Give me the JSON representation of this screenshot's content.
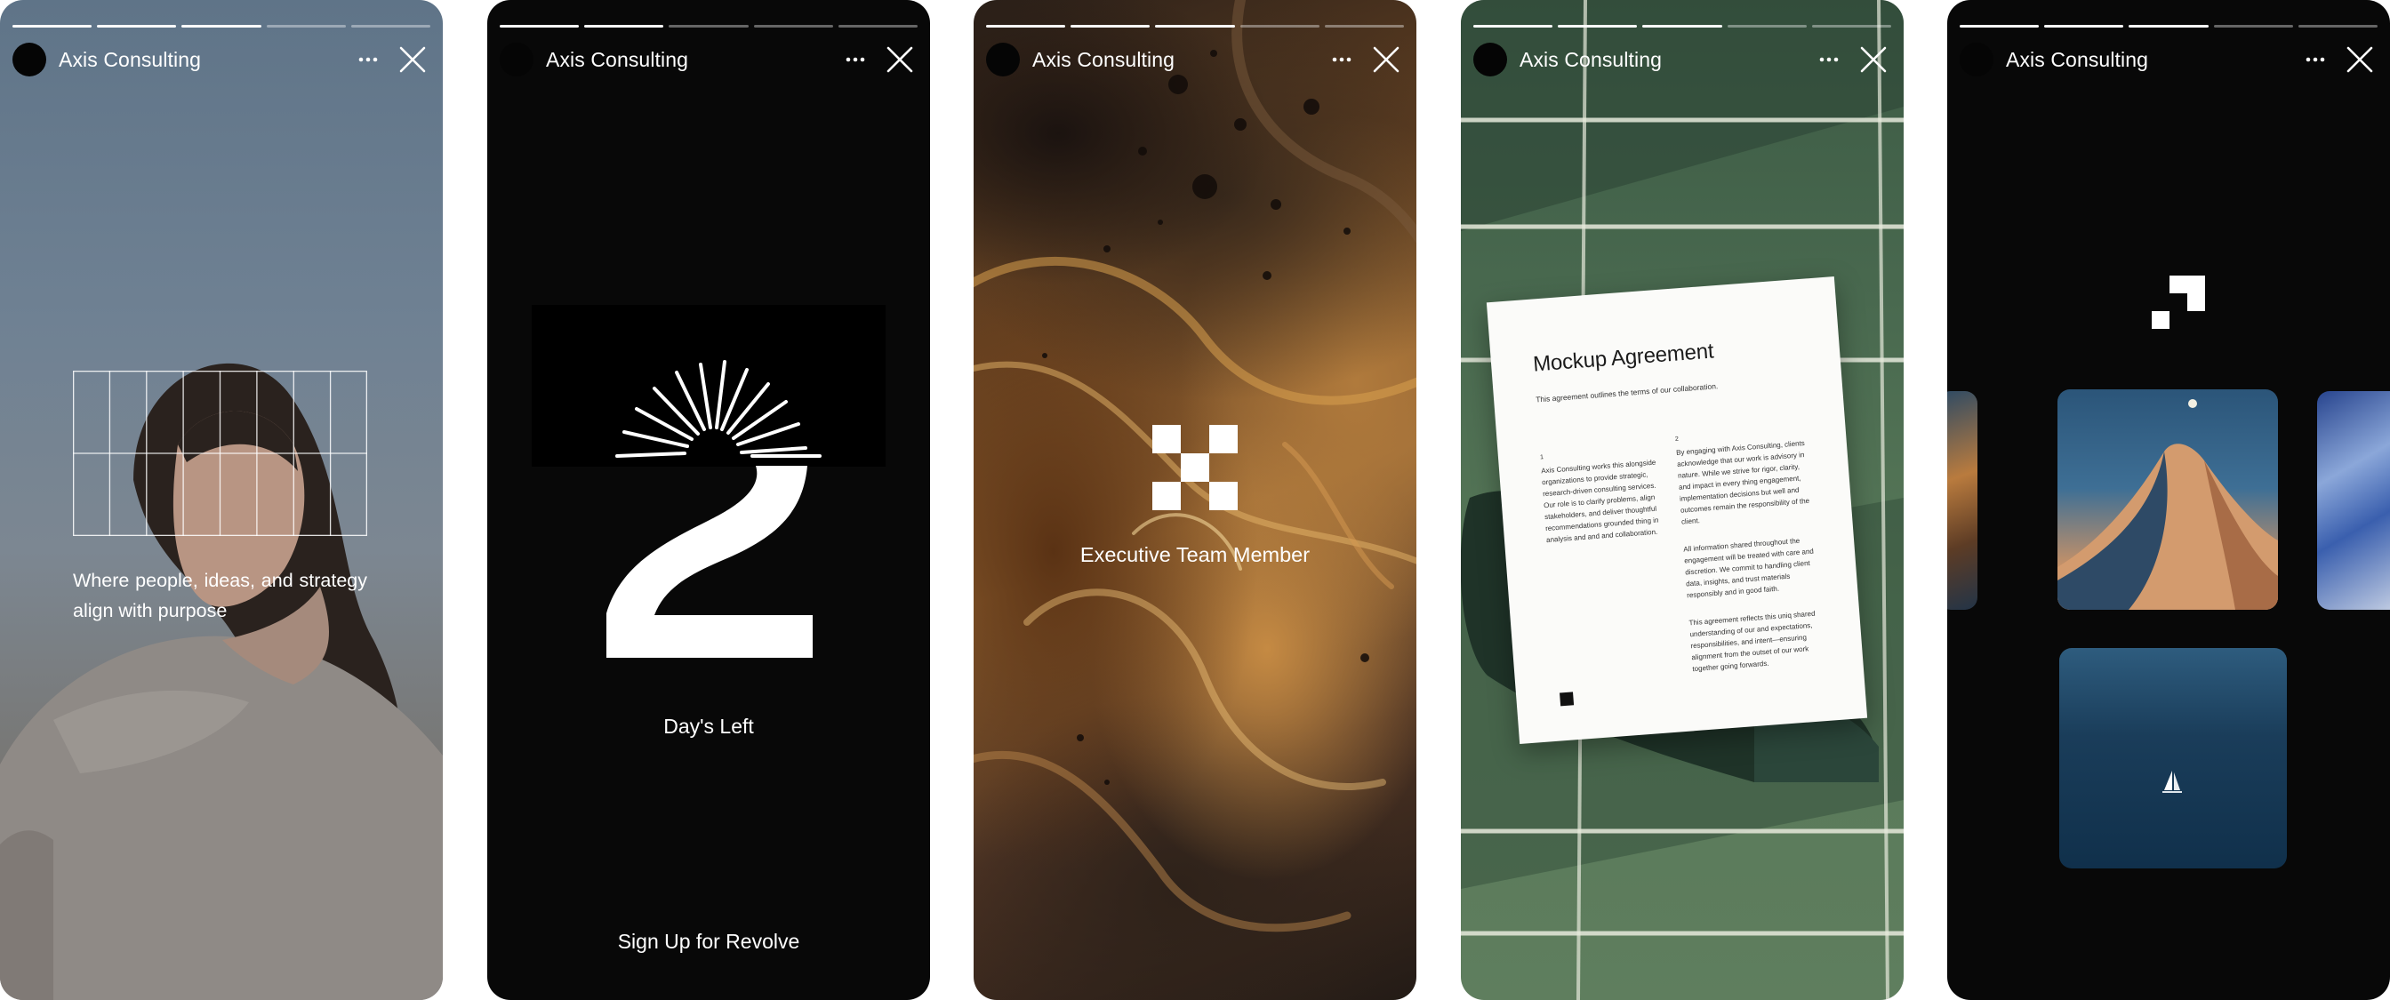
{
  "stories": [
    {
      "account_name": "Axis Consulting",
      "progress": {
        "total": 5,
        "completed": 3
      },
      "caption": "Where people, ideas, and strategy align with purpose"
    },
    {
      "account_name": "Axis Consulting",
      "progress": {
        "total": 5,
        "completed": 2
      },
      "countdown_label": "Day's Left",
      "cta": "Sign Up for Revolve"
    },
    {
      "account_name": "Axis Consulting",
      "progress": {
        "total": 5,
        "completed": 3
      },
      "title": "Executive Team Member"
    },
    {
      "account_name": "Axis Consulting",
      "progress": {
        "total": 5,
        "completed": 3
      },
      "document": {
        "title": "Mockup Agreement",
        "subtitle": "This agreement outlines the terms of our collaboration.",
        "col1_num": "1",
        "col1_text": "Axis Consulting works this alongside organizations to provide strategic, research-driven consulting services. Our role is to clarify problems, align stakeholders, and deliver thoughtful recommendations grounded thing in analysis and and and collaboration.",
        "col2_num": "2",
        "col2_p1": "By engaging with Axis Consulting, clients acknowledge that our work is advisory in nature. While we strive for rigor, clarity, and impact in every thing engagement, implementation decisions but well and outcomes remain the responsibility of the client.",
        "col2_p2": "All information shared throughout the engagement will be treated with care and discretion. We commit to handling client data, insights, and trust materials responsibly and in good faith.",
        "col2_p3": "This agreement reflects this uniq shared understanding of our and expectations, responsibilities, and intent—ensuring alignment from the outset of our work together going forwards."
      }
    },
    {
      "account_name": "Axis Consulting",
      "progress": {
        "total": 5,
        "completed": 3
      }
    }
  ],
  "icons": {
    "more": "more-horizontal-icon",
    "close": "close-icon",
    "story2_art": "sunrise-icon",
    "story3_logo": "checker-logo-icon",
    "story5_logo": "corner-logo-icon"
  },
  "colors": {
    "text": "#ffffff",
    "dark_story_bg": "#080808",
    "progress_done": "#ffffff",
    "progress_pending": "rgba(255,255,255,0.38)"
  }
}
